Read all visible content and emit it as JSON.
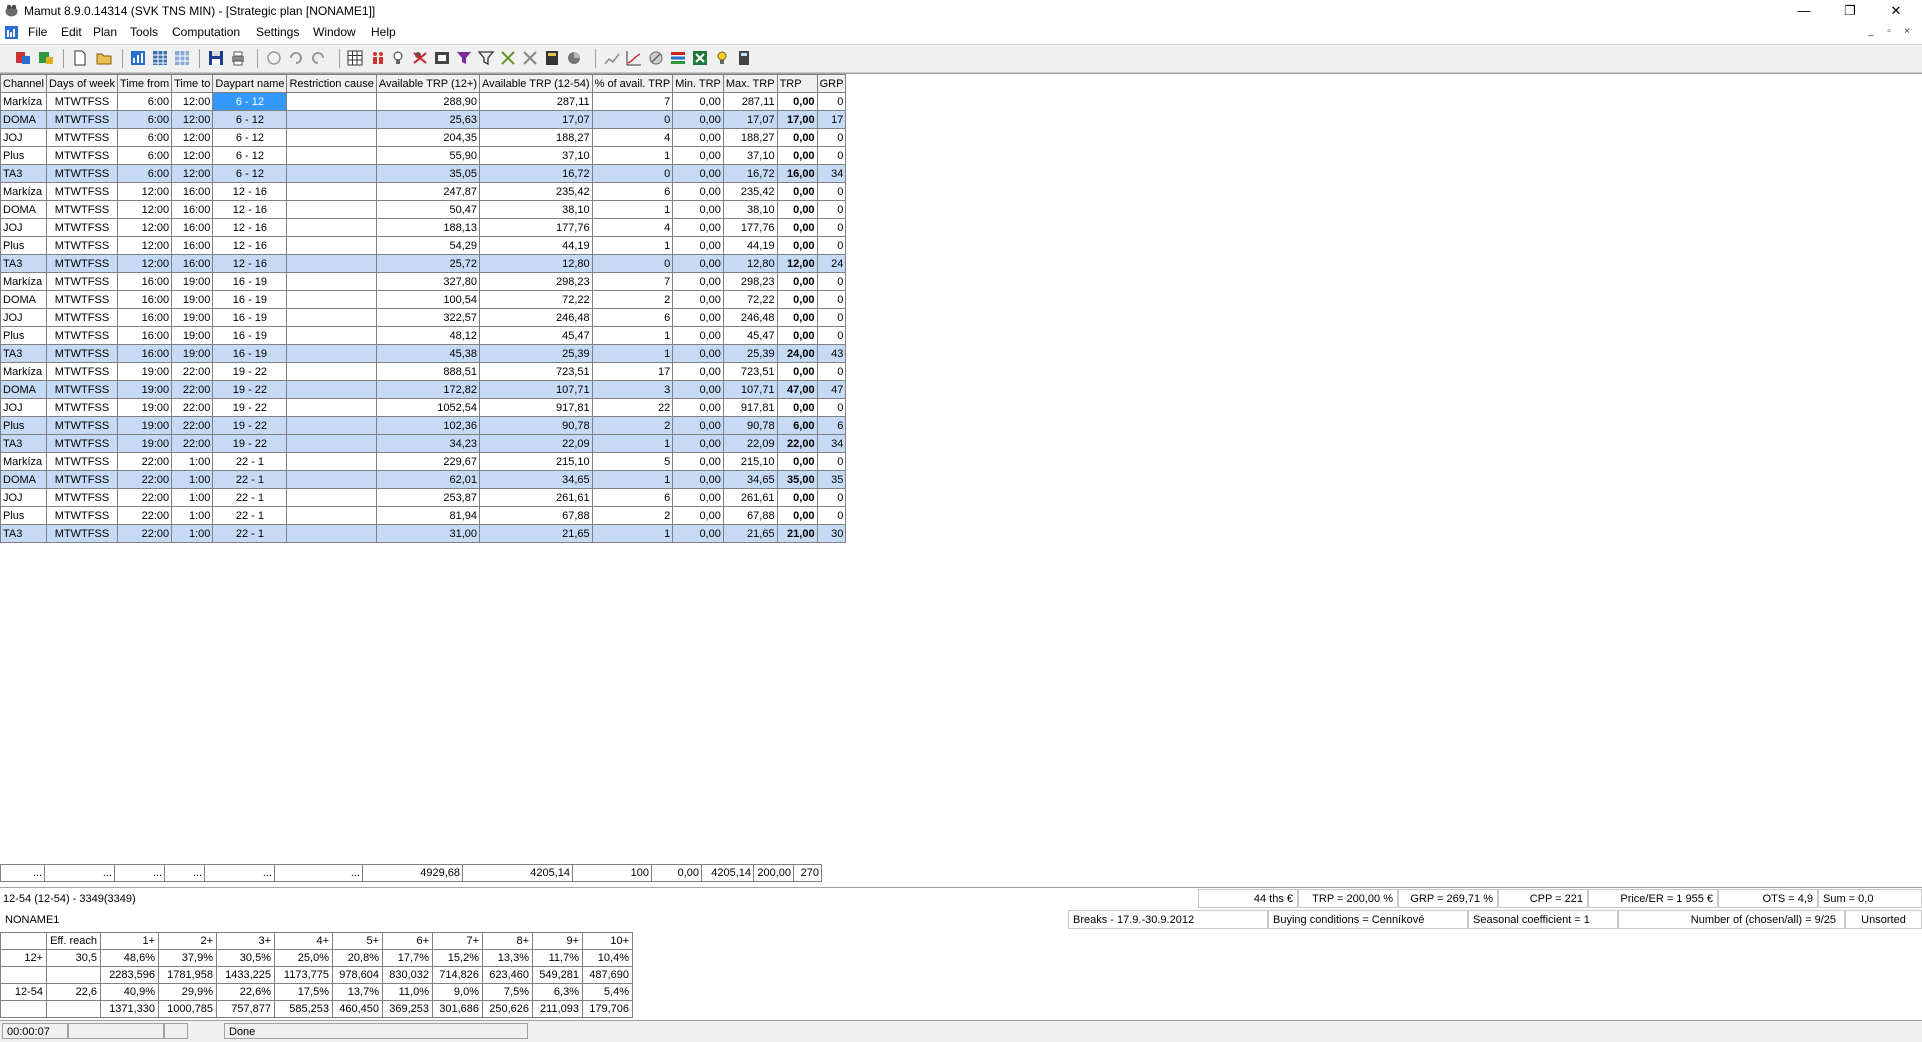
{
  "window": {
    "title": "Mamut 8.9.0.14314 (SVK TNS MIN) - [Strategic plan [NONAME1]]",
    "minimize": "—",
    "restore": "❐",
    "close": "✕"
  },
  "menu": [
    "File",
    "Edit",
    "Plan",
    "Tools",
    "Computation",
    "Settings",
    "Window",
    "Help"
  ],
  "grid": {
    "columns": [
      "Channel",
      "Days of week",
      "Time from",
      "Time to",
      "Daypart name",
      "Restriction cause",
      "Available TRP (12+)",
      "Available TRP (12-54)",
      "% of avail. TRP",
      "Min. TRP",
      "Max. TRP",
      "TRP",
      "GRP"
    ],
    "rows": [
      {
        "channel": "Markíza",
        "days": "MTWTFSS",
        "from": "6:00",
        "to": "12:00",
        "daypart": "6 - 12",
        "cause": "",
        "a12": "288,90",
        "a1254": "287,11",
        "pct": "7",
        "min": "0,00",
        "max": "287,11",
        "trp": "0,00",
        "grp": "0"
      },
      {
        "channel": "DOMA",
        "days": "MTWTFSS",
        "from": "6:00",
        "to": "12:00",
        "daypart": "6 - 12",
        "cause": "",
        "a12": "25,63",
        "a1254": "17,07",
        "pct": "0",
        "min": "0,00",
        "max": "17,07",
        "trp": "17,00",
        "grp": "17"
      },
      {
        "channel": "JOJ",
        "days": "MTWTFSS",
        "from": "6:00",
        "to": "12:00",
        "daypart": "6 - 12",
        "cause": "",
        "a12": "204,35",
        "a1254": "188,27",
        "pct": "4",
        "min": "0,00",
        "max": "188,27",
        "trp": "0,00",
        "grp": "0"
      },
      {
        "channel": "Plus",
        "days": "MTWTFSS",
        "from": "6:00",
        "to": "12:00",
        "daypart": "6 - 12",
        "cause": "",
        "a12": "55,90",
        "a1254": "37,10",
        "pct": "1",
        "min": "0,00",
        "max": "37,10",
        "trp": "0,00",
        "grp": "0"
      },
      {
        "channel": "TA3",
        "days": "MTWTFSS",
        "from": "6:00",
        "to": "12:00",
        "daypart": "6 - 12",
        "cause": "",
        "a12": "35,05",
        "a1254": "16,72",
        "pct": "0",
        "min": "0,00",
        "max": "16,72",
        "trp": "16,00",
        "grp": "34"
      },
      {
        "channel": "Markíza",
        "days": "MTWTFSS",
        "from": "12:00",
        "to": "16:00",
        "daypart": "12 - 16",
        "cause": "",
        "a12": "247,87",
        "a1254": "235,42",
        "pct": "6",
        "min": "0,00",
        "max": "235,42",
        "trp": "0,00",
        "grp": "0"
      },
      {
        "channel": "DOMA",
        "days": "MTWTFSS",
        "from": "12:00",
        "to": "16:00",
        "daypart": "12 - 16",
        "cause": "",
        "a12": "50,47",
        "a1254": "38,10",
        "pct": "1",
        "min": "0,00",
        "max": "38,10",
        "trp": "0,00",
        "grp": "0"
      },
      {
        "channel": "JOJ",
        "days": "MTWTFSS",
        "from": "12:00",
        "to": "16:00",
        "daypart": "12 - 16",
        "cause": "",
        "a12": "188,13",
        "a1254": "177,76",
        "pct": "4",
        "min": "0,00",
        "max": "177,76",
        "trp": "0,00",
        "grp": "0"
      },
      {
        "channel": "Plus",
        "days": "MTWTFSS",
        "from": "12:00",
        "to": "16:00",
        "daypart": "12 - 16",
        "cause": "",
        "a12": "54,29",
        "a1254": "44,19",
        "pct": "1",
        "min": "0,00",
        "max": "44,19",
        "trp": "0,00",
        "grp": "0"
      },
      {
        "channel": "TA3",
        "days": "MTWTFSS",
        "from": "12:00",
        "to": "16:00",
        "daypart": "12 - 16",
        "cause": "",
        "a12": "25,72",
        "a1254": "12,80",
        "pct": "0",
        "min": "0,00",
        "max": "12,80",
        "trp": "12,00",
        "grp": "24"
      },
      {
        "channel": "Markíza",
        "days": "MTWTFSS",
        "from": "16:00",
        "to": "19:00",
        "daypart": "16 - 19",
        "cause": "",
        "a12": "327,80",
        "a1254": "298,23",
        "pct": "7",
        "min": "0,00",
        "max": "298,23",
        "trp": "0,00",
        "grp": "0"
      },
      {
        "channel": "DOMA",
        "days": "MTWTFSS",
        "from": "16:00",
        "to": "19:00",
        "daypart": "16 - 19",
        "cause": "",
        "a12": "100,54",
        "a1254": "72,22",
        "pct": "2",
        "min": "0,00",
        "max": "72,22",
        "trp": "0,00",
        "grp": "0"
      },
      {
        "channel": "JOJ",
        "days": "MTWTFSS",
        "from": "16:00",
        "to": "19:00",
        "daypart": "16 - 19",
        "cause": "",
        "a12": "322,57",
        "a1254": "246,48",
        "pct": "6",
        "min": "0,00",
        "max": "246,48",
        "trp": "0,00",
        "grp": "0"
      },
      {
        "channel": "Plus",
        "days": "MTWTFSS",
        "from": "16:00",
        "to": "19:00",
        "daypart": "16 - 19",
        "cause": "",
        "a12": "48,12",
        "a1254": "45,47",
        "pct": "1",
        "min": "0,00",
        "max": "45,47",
        "trp": "0,00",
        "grp": "0"
      },
      {
        "channel": "TA3",
        "days": "MTWTFSS",
        "from": "16:00",
        "to": "19:00",
        "daypart": "16 - 19",
        "cause": "",
        "a12": "45,38",
        "a1254": "25,39",
        "pct": "1",
        "min": "0,00",
        "max": "25,39",
        "trp": "24,00",
        "grp": "43"
      },
      {
        "channel": "Markíza",
        "days": "MTWTFSS",
        "from": "19:00",
        "to": "22:00",
        "daypart": "19 - 22",
        "cause": "",
        "a12": "888,51",
        "a1254": "723,51",
        "pct": "17",
        "min": "0,00",
        "max": "723,51",
        "trp": "0,00",
        "grp": "0"
      },
      {
        "channel": "DOMA",
        "days": "MTWTFSS",
        "from": "19:00",
        "to": "22:00",
        "daypart": "19 - 22",
        "cause": "",
        "a12": "172,82",
        "a1254": "107,71",
        "pct": "3",
        "min": "0,00",
        "max": "107,71",
        "trp": "47,00",
        "grp": "47"
      },
      {
        "channel": "JOJ",
        "days": "MTWTFSS",
        "from": "19:00",
        "to": "22:00",
        "daypart": "19 - 22",
        "cause": "",
        "a12": "1052,54",
        "a1254": "917,81",
        "pct": "22",
        "min": "0,00",
        "max": "917,81",
        "trp": "0,00",
        "grp": "0"
      },
      {
        "channel": "Plus",
        "days": "MTWTFSS",
        "from": "19:00",
        "to": "22:00",
        "daypart": "19 - 22",
        "cause": "",
        "a12": "102,36",
        "a1254": "90,78",
        "pct": "2",
        "min": "0,00",
        "max": "90,78",
        "trp": "6,00",
        "grp": "6"
      },
      {
        "channel": "TA3",
        "days": "MTWTFSS",
        "from": "19:00",
        "to": "22:00",
        "daypart": "19 - 22",
        "cause": "",
        "a12": "34,23",
        "a1254": "22,09",
        "pct": "1",
        "min": "0,00",
        "max": "22,09",
        "trp": "22,00",
        "grp": "34"
      },
      {
        "channel": "Markíza",
        "days": "MTWTFSS",
        "from": "22:00",
        "to": "1:00",
        "daypart": "22 - 1",
        "cause": "",
        "a12": "229,67",
        "a1254": "215,10",
        "pct": "5",
        "min": "0,00",
        "max": "215,10",
        "trp": "0,00",
        "grp": "0"
      },
      {
        "channel": "DOMA",
        "days": "MTWTFSS",
        "from": "22:00",
        "to": "1:00",
        "daypart": "22 - 1",
        "cause": "",
        "a12": "62,01",
        "a1254": "34,65",
        "pct": "1",
        "min": "0,00",
        "max": "34,65",
        "trp": "35,00",
        "grp": "35"
      },
      {
        "channel": "JOJ",
        "days": "MTWTFSS",
        "from": "22:00",
        "to": "1:00",
        "daypart": "22 - 1",
        "cause": "",
        "a12": "253,87",
        "a1254": "261,61",
        "pct": "6",
        "min": "0,00",
        "max": "261,61",
        "trp": "0,00",
        "grp": "0"
      },
      {
        "channel": "Plus",
        "days": "MTWTFSS",
        "from": "22:00",
        "to": "1:00",
        "daypart": "22 - 1",
        "cause": "",
        "a12": "81,94",
        "a1254": "67,88",
        "pct": "2",
        "min": "0,00",
        "max": "67,88",
        "trp": "0,00",
        "grp": "0"
      },
      {
        "channel": "TA3",
        "days": "MTWTFSS",
        "from": "22:00",
        "to": "1:00",
        "daypart": "22 - 1",
        "cause": "",
        "a12": "31,00",
        "a1254": "21,65",
        "pct": "1",
        "min": "0,00",
        "max": "21,65",
        "trp": "21,00",
        "grp": "30"
      }
    ],
    "highlight_rows": [
      1,
      4,
      9,
      14,
      16,
      18,
      19,
      21,
      24
    ],
    "selected_cell": {
      "row": 0,
      "col": "daypart"
    },
    "selection_color": "#3399ff",
    "highlight_color": "#c6daf6"
  },
  "totals": [
    "...",
    "...",
    "...",
    "...",
    "...",
    "...",
    "4929,68",
    "4205,14",
    "100",
    "0,00",
    "4205,14",
    "200,00",
    "270"
  ],
  "summary": {
    "target": "12-54 (12-54) - 3349(3349)",
    "cost": "44 ths €",
    "trp": "TRP =   200,00 %",
    "grp": "GRP =   269,71 %",
    "cpp": "CPP =    221",
    "price_er": "Price/ER =   1 955 €",
    "ots": "OTS = 4,9",
    "sum": "Sum =    0,0"
  },
  "info": {
    "plan_name": "NONAME1",
    "breaks": "Breaks - 17.9.-30.9.2012",
    "buying": "Buying conditions = Cenníkové",
    "seasonal": "Seasonal coefficient = 1",
    "number": "Number of (chosen/all) = 9/25",
    "sort": "Unsorted"
  },
  "reach": {
    "headers": [
      "",
      "Eff. reach",
      "1+",
      "2+",
      "3+",
      "4+",
      "5+",
      "6+",
      "7+",
      "8+",
      "9+",
      "10+"
    ],
    "rows": [
      [
        "12+",
        "30,5",
        "48,6%",
        "37,9%",
        "30,5%",
        "25,0%",
        "20,8%",
        "17,7%",
        "15,2%",
        "13,3%",
        "11,7%",
        "10,4%"
      ],
      [
        "",
        "",
        "2283,596",
        "1781,958",
        "1433,225",
        "1173,775",
        "978,604",
        "830,032",
        "714,826",
        "623,460",
        "549,281",
        "487,690"
      ],
      [
        "12-54",
        "22,6",
        "40,9%",
        "29,9%",
        "22,6%",
        "17,5%",
        "13,7%",
        "11,0%",
        "9,0%",
        "7,5%",
        "6,3%",
        "5,4%"
      ],
      [
        "",
        "",
        "1371,330",
        "1000,785",
        "757,877",
        "585,253",
        "460,450",
        "369,253",
        "301,686",
        "250,626",
        "211,093",
        "179,706"
      ]
    ]
  },
  "status": {
    "time": "00:00:07",
    "p2": "",
    "p3": "",
    "state": "Done"
  }
}
